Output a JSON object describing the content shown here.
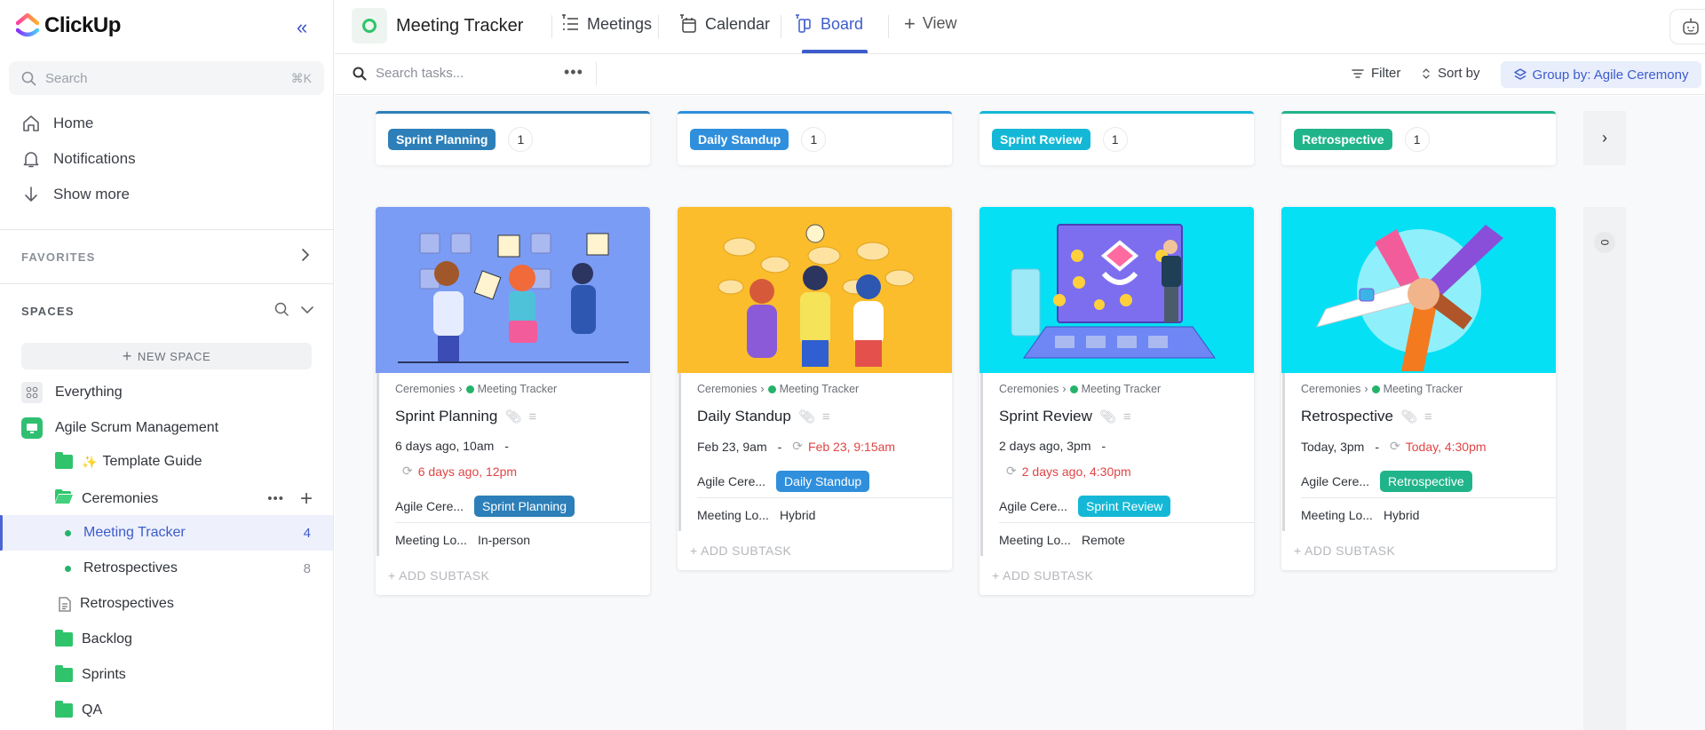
{
  "app": {
    "name": "ClickUp"
  },
  "sidebar": {
    "search": {
      "placeholder": "Search",
      "shortcut": "⌘K"
    },
    "nav": [
      {
        "label": "Home",
        "icon": "home-icon"
      },
      {
        "label": "Notifications",
        "icon": "bell-icon"
      },
      {
        "label": "Show more",
        "icon": "arrow-down-icon"
      }
    ],
    "favorites_label": "FAVORITES",
    "spaces_label": "SPACES",
    "new_space_label": "NEW SPACE",
    "tree": [
      {
        "label": "Everything",
        "type": "everything"
      },
      {
        "label": "Agile Scrum Management",
        "type": "space"
      },
      {
        "label": "Template Guide",
        "type": "folder",
        "emoji": "✨"
      },
      {
        "label": "Ceremonies",
        "type": "folder-open"
      },
      {
        "label": "Meeting Tracker",
        "type": "list",
        "count": "4",
        "active": true
      },
      {
        "label": "Retrospectives",
        "type": "list",
        "count": "8"
      },
      {
        "label": "Retrospectives",
        "type": "doc"
      },
      {
        "label": "Backlog",
        "type": "folder"
      },
      {
        "label": "Sprints",
        "type": "folder"
      },
      {
        "label": "QA",
        "type": "folder"
      }
    ]
  },
  "header": {
    "title": "Meeting Tracker",
    "tabs": [
      {
        "label": "Meetings",
        "icon": "list-icon"
      },
      {
        "label": "Calendar",
        "icon": "calendar-icon"
      },
      {
        "label": "Board",
        "icon": "board-icon",
        "active": true
      }
    ],
    "add_view_label": "View"
  },
  "toolbar": {
    "search_placeholder": "Search tasks...",
    "filter_label": "Filter",
    "sort_label": "Sort by",
    "group_label": "Group by: Agile Ceremony"
  },
  "colors": {
    "sprint_planning": "#2c7fb8",
    "daily_standup": "#2f8fdc",
    "sprint_review": "#14b8d6",
    "retrospective": "#20b48a",
    "overdue": "#e04545",
    "accent": "#3d5ccc"
  },
  "board": {
    "columns": [
      {
        "label": "Sprint Planning",
        "count": "1"
      },
      {
        "label": "Daily Standup",
        "count": "1"
      },
      {
        "label": "Sprint Review",
        "count": "1"
      },
      {
        "label": "Retrospective",
        "count": "1"
      }
    ],
    "hidden_column_count": "0",
    "cards": [
      {
        "breadcrumb_parent": "Ceremonies",
        "breadcrumb_list": "Meeting Tracker",
        "title": "Sprint Planning",
        "start": "6 days ago, 10am",
        "due": "6 days ago, 12pm",
        "field1_label": "Agile Cere...",
        "field1_value": "Sprint Planning",
        "field2_label": "Meeting Lo...",
        "field2_value": "In-person",
        "add_subtask": "+ ADD SUBTASK"
      },
      {
        "breadcrumb_parent": "Ceremonies",
        "breadcrumb_list": "Meeting Tracker",
        "title": "Daily Standup",
        "start": "Feb 23, 9am",
        "due": "Feb 23, 9:15am",
        "field1_label": "Agile Cere...",
        "field1_value": "Daily Standup",
        "field2_label": "Meeting Lo...",
        "field2_value": "Hybrid",
        "add_subtask": "+ ADD SUBTASK"
      },
      {
        "breadcrumb_parent": "Ceremonies",
        "breadcrumb_list": "Meeting Tracker",
        "title": "Sprint Review",
        "start": "2 days ago, 3pm",
        "due": "2 days ago, 4:30pm",
        "field1_label": "Agile Cere...",
        "field1_value": "Sprint Review",
        "field2_label": "Meeting Lo...",
        "field2_value": "Remote",
        "add_subtask": "+ ADD SUBTASK"
      },
      {
        "breadcrumb_parent": "Ceremonies",
        "breadcrumb_list": "Meeting Tracker",
        "title": "Retrospective",
        "start": "Today, 3pm",
        "due": "Today, 4:30pm",
        "field1_label": "Agile Cere...",
        "field1_value": "Retrospective",
        "field2_label": "Meeting Lo...",
        "field2_value": "Hybrid",
        "add_subtask": "+ ADD SUBTASK"
      }
    ]
  }
}
